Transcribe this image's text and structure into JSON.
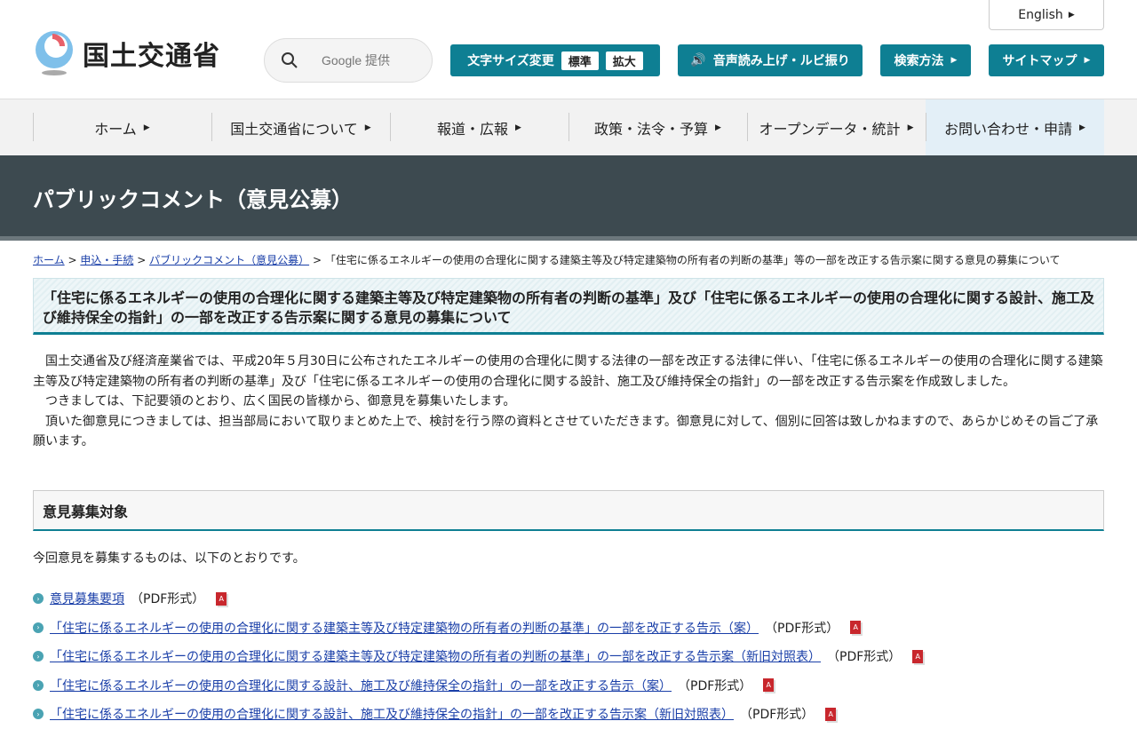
{
  "header": {
    "english": "English",
    "logo_text": "国土交通省",
    "search_placeholder": "Google 提供",
    "font_size": {
      "label": "文字サイズ変更",
      "standard": "標準",
      "large": "拡大"
    },
    "speech": "音声読み上げ・ルビ振り",
    "search_method": "検索方法",
    "sitemap": "サイトマップ"
  },
  "nav": [
    "ホーム",
    "国土交通省について",
    "報道・広報",
    "政策・法令・予算",
    "オープンデータ・統計",
    "お問い合わせ・申請"
  ],
  "banner": "パブリックコメント（意見公募）",
  "breadcrumb": {
    "items": [
      "ホーム",
      "申込・手続",
      "パブリックコメント（意見公募）"
    ],
    "current": "「住宅に係るエネルギーの使用の合理化に関する建築主等及び特定建築物の所有者の判断の基準」等の一部を改正する告示案に関する意見の募集について",
    "sep": ">"
  },
  "title": "「住宅に係るエネルギーの使用の合理化に関する建築主等及び特定建築物の所有者の判断の基準」及び「住宅に係るエネルギーの使用の合理化に関する設計、施工及び維持保全の指針」の一部を改正する告示案に関する意見の募集について",
  "paragraphs": [
    "国土交通省及び経済産業省では、平成20年５月30日に公布されたエネルギーの使用の合理化に関する法律の一部を改正する法律に伴い、「住宅に係るエネルギーの使用の合理化に関する建築主等及び特定建築物の所有者の判断の基準」及び「住宅に係るエネルギーの使用の合理化に関する設計、施工及び維持保全の指針」の一部を改正する告示案を作成致しました。",
    "つきましては、下記要領のとおり、広く国民の皆様から、御意見を募集いたします。",
    "頂いた御意見につきましては、担当部局において取りまとめた上で、検討を行う際の資料とさせていただきます。御意見に対して、個別に回答は致しかねますので、あらかじめその旨ご了承願います。"
  ],
  "section": {
    "heading": "意見募集対象",
    "intro": "今回意見を募集するものは、以下のとおりです。",
    "items": [
      {
        "link": "意見募集要項",
        "format": "（PDF形式）"
      },
      {
        "link": "「住宅に係るエネルギーの使用の合理化に関する建築主等及び特定建築物の所有者の判断の基準」の一部を改正する告示（案）",
        "format": "（PDF形式）"
      },
      {
        "link": "「住宅に係るエネルギーの使用の合理化に関する建築主等及び特定建築物の所有者の判断の基準」の一部を改正する告示案（新旧対照表）",
        "format": "（PDF形式）"
      },
      {
        "link": "「住宅に係るエネルギーの使用の合理化に関する設計、施工及び維持保全の指針」の一部を改正する告示（案）",
        "format": "（PDF形式）"
      },
      {
        "link": "「住宅に係るエネルギーの使用の合理化に関する設計、施工及び維持保全の指針」の一部を改正する告示案（新旧対照表）",
        "format": "（PDF形式）"
      }
    ]
  },
  "colors": {
    "accent": "#0e7f93",
    "banner": "#3d4a50",
    "link": "#1a3fa8"
  }
}
